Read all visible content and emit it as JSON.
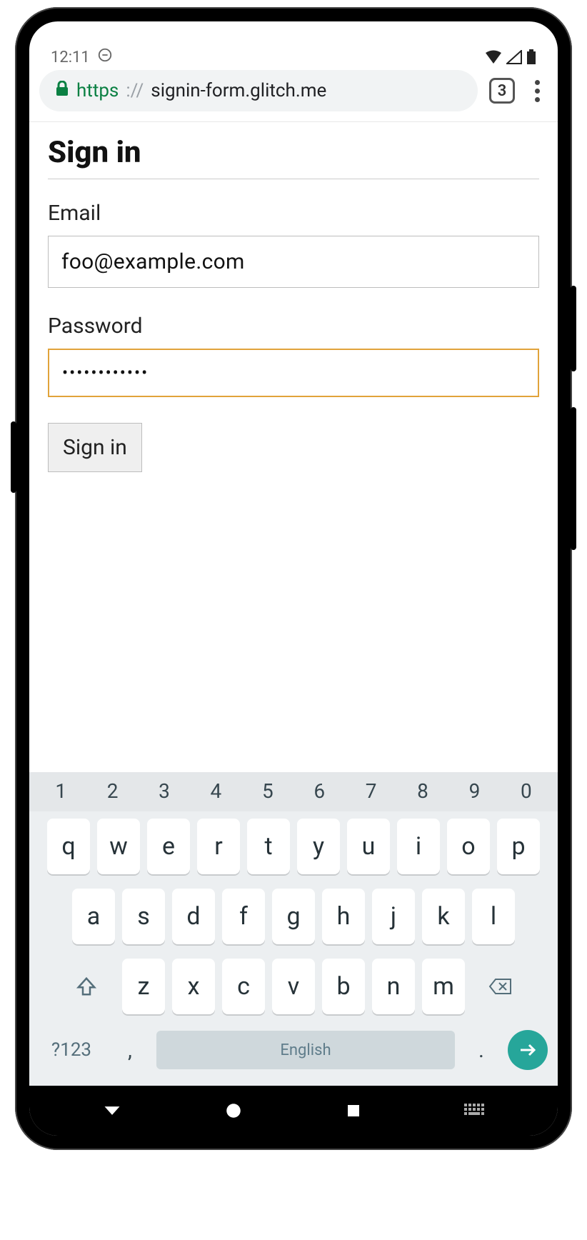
{
  "status": {
    "time": "12:11",
    "tab_count": "3"
  },
  "url": {
    "scheme": "https",
    "sep": "://",
    "host": "signin-form.glitch.me"
  },
  "page": {
    "heading": "Sign in",
    "email_label": "Email",
    "email_value": "foo@example.com",
    "password_label": "Password",
    "password_value": "••••••••••••",
    "submit_label": "Sign in"
  },
  "keyboard": {
    "numbers": [
      "1",
      "2",
      "3",
      "4",
      "5",
      "6",
      "7",
      "8",
      "9",
      "0"
    ],
    "row1": [
      "q",
      "w",
      "e",
      "r",
      "t",
      "y",
      "u",
      "i",
      "o",
      "p"
    ],
    "row2": [
      "a",
      "s",
      "d",
      "f",
      "g",
      "h",
      "j",
      "k",
      "l"
    ],
    "row3": [
      "z",
      "x",
      "c",
      "v",
      "b",
      "n",
      "m"
    ],
    "symbols_label": "?123",
    "comma": ",",
    "space_label": "English",
    "period": "."
  }
}
